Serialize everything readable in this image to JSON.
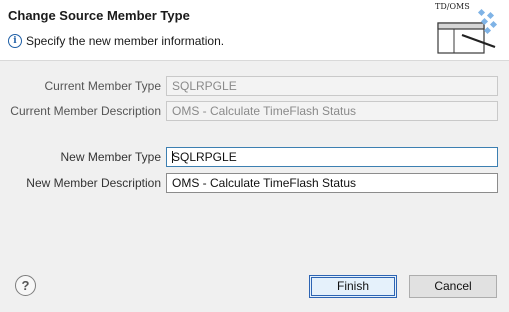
{
  "dialog": {
    "title": "Change Source Member Type",
    "message": "Specify the new member information.",
    "wizard_caption": "TD/OMS"
  },
  "current": {
    "type_label": "Current Member Type",
    "type_value": "SQLRPGLE",
    "description_label": "Current Member Description",
    "description_value": "OMS - Calculate TimeFlash Status"
  },
  "new": {
    "type_label": "New Member Type",
    "type_value": "SQLRPGLE",
    "description_label": "New Member Description",
    "description_value": "OMS - Calculate TimeFlash Status"
  },
  "buttons": {
    "help": "?",
    "finish": "Finish",
    "cancel": "Cancel"
  },
  "icons": {
    "info": "info-icon",
    "help": "help-icon",
    "wizard": "wizard-banner-icon"
  },
  "colors": {
    "banner_bg": "#ffffff",
    "dialog_bg": "#f0f0f0",
    "default_button_border": "#2d64b3"
  }
}
